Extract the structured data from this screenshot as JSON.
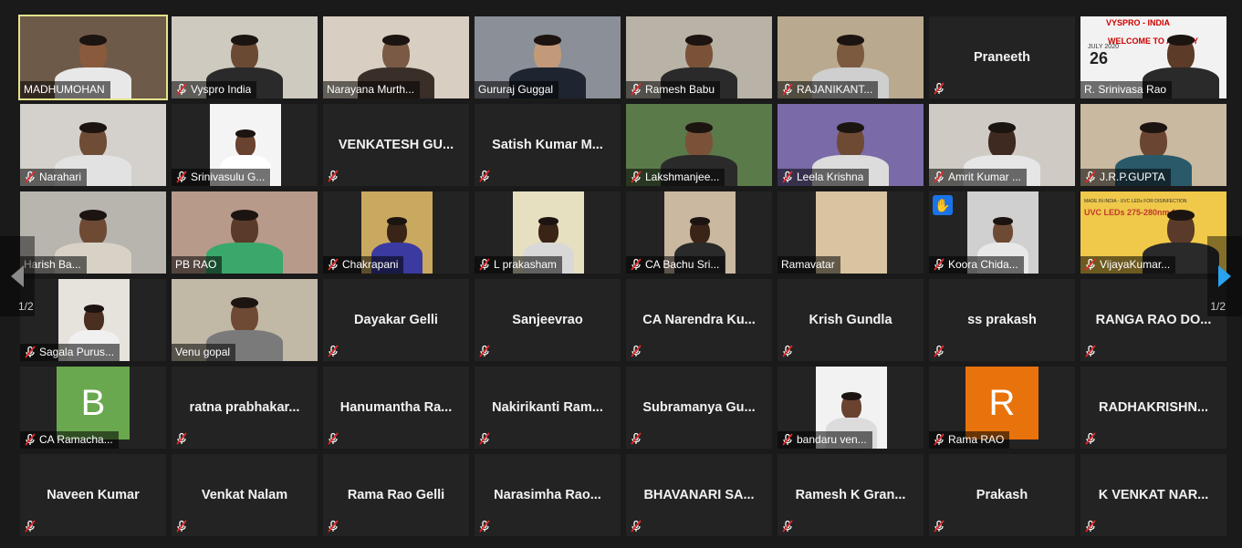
{
  "pagination": {
    "left_label": "1/2",
    "right_label": "1/2"
  },
  "colors": {
    "mute_icon": "#e02828",
    "active_border": "#e3e38a",
    "arrow_right": "#2aa3ef"
  },
  "participants": [
    {
      "name": "MADHUMOHAN",
      "video": true,
      "active": true,
      "muted": false,
      "bg": "#6e5a48",
      "skin": "#8a5a3c",
      "shirt": "#e8e8e8"
    },
    {
      "name": "Vyspro India",
      "video": true,
      "muted": true,
      "bg": "#cfcac0",
      "skin": "#6b4a34",
      "shirt": "#2a2a2a"
    },
    {
      "name": "Narayana Murth...",
      "video": true,
      "muted": false,
      "bg": "#d8cfc2",
      "skin": "#7a5a44",
      "shirt": "#3a2e28"
    },
    {
      "name": "Gururaj Guggal",
      "video": true,
      "muted": false,
      "bg": "#8a8f98",
      "skin": "#c29a7a",
      "shirt": "#1e2430"
    },
    {
      "name": "Ramesh Babu",
      "video": true,
      "muted": true,
      "bg": "#b9b2a6",
      "skin": "#7a5238",
      "shirt": "#2a2a2a"
    },
    {
      "name": "RAJANIKANT...",
      "video": true,
      "muted": true,
      "bg": "#b9a98f",
      "skin": "#7c5a40",
      "shirt": "#cfcfcf"
    },
    {
      "name": "Praneeth",
      "video": false,
      "muted": true
    },
    {
      "name": "R. Srinivasa Rao",
      "video": true,
      "muted": false,
      "poster": true,
      "bg": "#f2f2f2",
      "skin": "#5c3b28",
      "shirt": "#2a2a2a",
      "poster_text": "VYSPRO - INDIA",
      "poster_sub": "WELCOME TO AGM FY",
      "poster_date": "JULY 2020",
      "poster_day": "26"
    },
    {
      "name": "Narahari",
      "video": true,
      "muted": true,
      "bg": "#d4d1cc",
      "skin": "#6e4c36",
      "shirt": "#e2e2e2"
    },
    {
      "name": "Srinivasulu G...",
      "video": true,
      "muted": true,
      "narrow": true,
      "bg": "#f4f4f4",
      "skin": "#6a4230",
      "shirt": "#ffffff"
    },
    {
      "name": "VENKATESH GU...",
      "video": false,
      "muted": true
    },
    {
      "name": "Satish Kumar M...",
      "video": false,
      "muted": true
    },
    {
      "name": "Lakshmanjee...",
      "video": true,
      "muted": true,
      "bg": "#5a7a4a",
      "skin": "#7a5238",
      "shirt": "#2a2a2a"
    },
    {
      "name": "Leela Krishna",
      "video": true,
      "muted": true,
      "bg": "#7a6aa8",
      "skin": "#6e4a34",
      "shirt": "#dcdcdc"
    },
    {
      "name": "Amrit Kumar ...",
      "video": true,
      "muted": true,
      "bg": "#cfcbc4",
      "skin": "#3e2a20",
      "shirt": "#e6e6e6"
    },
    {
      "name": "J.R.P.GUPTA",
      "video": true,
      "muted": true,
      "bg": "#c9b9a0",
      "skin": "#6a4632",
      "shirt": "#2a5a6a"
    },
    {
      "name": "Harish Ba...",
      "video": true,
      "muted": false,
      "bg": "#b8b4ae",
      "skin": "#6e4a34",
      "shirt": "#d8d2c6"
    },
    {
      "name": "PB RAO",
      "video": true,
      "muted": false,
      "bg": "#b89a8a",
      "skin": "#5a3a28",
      "shirt": "#3aa86a"
    },
    {
      "name": "Chakrapani",
      "video": true,
      "muted": true,
      "narrow": true,
      "bg": "#c9a860",
      "skin": "#3a2418",
      "shirt": "#3a3aa0"
    },
    {
      "name": "L prakasham",
      "video": true,
      "muted": true,
      "narrow": true,
      "bg": "#e6e0c0",
      "skin": "#3a2418",
      "shirt": "#d8d8d8"
    },
    {
      "name": "CA Bachu Sri...",
      "video": true,
      "muted": true,
      "narrow": true,
      "bg": "#cbb8a0",
      "skin": "#3a2418",
      "shirt": "#2a2a2a"
    },
    {
      "name": "Ramavatar",
      "video": true,
      "muted": false,
      "narrow": true,
      "bg": "#d8c4a0",
      "skin": "#c9a070",
      "shirt": "#a06a30",
      "empty": true
    },
    {
      "name": "Koora Chida...",
      "video": true,
      "muted": true,
      "narrow": true,
      "hand": true,
      "bg": "#d0d0d0",
      "skin": "#6e4a34",
      "shirt": "#e8e8e8"
    },
    {
      "name": "VijayaKumar...",
      "video": true,
      "muted": true,
      "poster2": true,
      "bg": "#f0c84a",
      "skin": "#5a3a28",
      "shirt": "#2a2a2a",
      "poster_text": "UVC LEDs 275-280nm for",
      "poster_sub": "MADE IN INDIA - UVC LEDs FOR DISINFECTION"
    },
    {
      "name": "Sagala Purus...",
      "video": true,
      "muted": true,
      "narrow": true,
      "bg": "#e6e2dc",
      "skin": "#4a2e20",
      "shirt": "#f0f0f0"
    },
    {
      "name": "Venu gopal",
      "video": true,
      "muted": false,
      "bg": "#c2b8a6",
      "skin": "#6e4a34",
      "shirt": "#7a7a7a"
    },
    {
      "name": "Dayakar Gelli",
      "video": false,
      "muted": true
    },
    {
      "name": "Sanjeevrao",
      "video": false,
      "muted": true
    },
    {
      "name": "CA Narendra Ku...",
      "video": false,
      "muted": true
    },
    {
      "name": "Krish Gundla",
      "video": false,
      "muted": true
    },
    {
      "name": "ss prakash",
      "video": false,
      "muted": true
    },
    {
      "name": "RANGA RAO DO...",
      "video": false,
      "muted": true
    },
    {
      "name": "CA Ramacha...",
      "video": false,
      "muted": true,
      "letter": "B",
      "letter_bg": "#6aa84f"
    },
    {
      "name": "ratna prabhakar...",
      "video": false,
      "muted": true
    },
    {
      "name": "Hanumantha Ra...",
      "video": false,
      "muted": true
    },
    {
      "name": "Nakirikanti Ram...",
      "video": false,
      "muted": true
    },
    {
      "name": "Subramanya Gu...",
      "video": false,
      "muted": true
    },
    {
      "name": "bandaru ven...",
      "video": true,
      "muted": true,
      "narrow": true,
      "bg": "#f2f2f2",
      "skin": "#6a4230",
      "shirt": "#dcdcdc"
    },
    {
      "name": "Rama RAO",
      "video": false,
      "muted": true,
      "letter": "R",
      "letter_bg": "#e8730c"
    },
    {
      "name": "RADHAKRISHN...",
      "video": false,
      "muted": true
    },
    {
      "name": "Naveen Kumar",
      "video": false,
      "muted": true
    },
    {
      "name": "Venkat Nalam",
      "video": false,
      "muted": true
    },
    {
      "name": "Rama Rao Gelli",
      "video": false,
      "muted": true
    },
    {
      "name": "Narasimha Rao...",
      "video": false,
      "muted": true
    },
    {
      "name": "BHAVANARI SA...",
      "video": false,
      "muted": true
    },
    {
      "name": "Ramesh K Gran...",
      "video": false,
      "muted": true
    },
    {
      "name": "Prakash",
      "video": false,
      "muted": true
    },
    {
      "name": "K VENKAT NAR...",
      "video": false,
      "muted": true
    }
  ]
}
